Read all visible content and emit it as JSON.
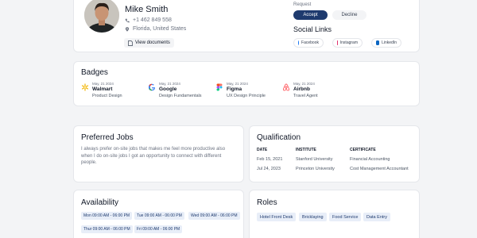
{
  "profile": {
    "name": "Mike Smith",
    "phone": "+1 462 849 558",
    "location": "Florida, United States",
    "view_documents": "View documents"
  },
  "request": {
    "label": "Request",
    "accept": "Accept",
    "decline": "Decline"
  },
  "social": {
    "title": "Social Links",
    "links": [
      {
        "label": "Facebook",
        "color": "#1877f2"
      },
      {
        "label": "Instagram",
        "color": "#e1306c"
      },
      {
        "label": "LinkedIn",
        "color": "#0a66c2"
      }
    ]
  },
  "badges": {
    "title": "Badges",
    "items": [
      {
        "date": "May, 21 2024",
        "name": "Walmart",
        "sub": "Product Design",
        "icon": "walmart-icon"
      },
      {
        "date": "May, 21 2024",
        "name": "Google",
        "sub": "Design Fundamentals",
        "icon": "google-icon"
      },
      {
        "date": "May, 21 2024",
        "name": "Figma",
        "sub": "UX Design Principle",
        "icon": "figma-icon"
      },
      {
        "date": "May, 21 2024",
        "name": "Airbnb",
        "sub": "Travel Agent",
        "icon": "airbnb-icon"
      }
    ]
  },
  "jobs": {
    "title": "Preferred Jobs",
    "text": "I always prefer on-site jobs that makes me feel more productive also when I do on-site jobs I got an opportunity to connect with different people."
  },
  "qualification": {
    "title": "Qualification",
    "headers": [
      "DATE",
      "INSTITUTE",
      "CERTIFICATE"
    ],
    "rows": [
      [
        "Feb 15, 2021",
        "Stanford University",
        "Financial Accounting"
      ],
      [
        "Jul 24, 2023",
        "Princeton University",
        "Cost Management Accountant"
      ]
    ]
  },
  "availability": {
    "title": "Availability",
    "slots": [
      "Mon 09:00 AM - 06:00 PM",
      "Tue 09:00 AM - 06:00 PM",
      "Wed 09:00 AM - 06:00 PM",
      "Thur 09:00 AM - 06:00 PM",
      "Fri 09:00 AM - 06:00 PM"
    ]
  },
  "roles": {
    "title": "Roles",
    "items": [
      "Hotel Front Desk",
      "Bricklaying",
      "Food Service",
      "Data Entry"
    ]
  }
}
